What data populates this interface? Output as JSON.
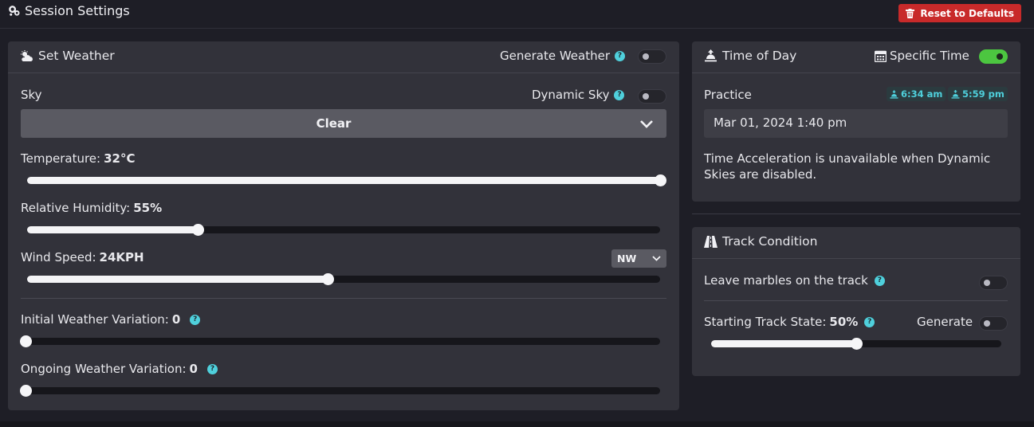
{
  "header": {
    "title": "Session Settings",
    "reset_label": "Reset to Defaults"
  },
  "weather": {
    "title": "Set Weather",
    "generate_label": "Generate Weather",
    "generate_on": false,
    "sky": {
      "label": "Sky",
      "dynamic_label": "Dynamic Sky",
      "dynamic_on": false,
      "selected": "Clear"
    },
    "temperature": {
      "label": "Temperature:",
      "value": "32°C",
      "fraction": 1.0
    },
    "humidity": {
      "label": "Relative Humidity:",
      "value": "55%",
      "fraction": 0.27
    },
    "wind": {
      "label": "Wind Speed:",
      "value": "24KPH",
      "direction": "NW",
      "fraction": 0.475
    },
    "initial_variation": {
      "label": "Initial Weather Variation:",
      "value": "0",
      "fraction": 0
    },
    "ongoing_variation": {
      "label": "Ongoing Weather Variation:",
      "value": "0",
      "fraction": 0
    }
  },
  "time": {
    "title": "Time of Day",
    "specific_label": "Specific Time",
    "specific_on": true,
    "session": "Practice",
    "sunrise": "6:34 am",
    "sunset": "5:59 pm",
    "datetime": "Mar 01, 2024 1:40 pm",
    "note": "Time Acceleration is unavailable when Dynamic Skies are disabled."
  },
  "track": {
    "title": "Track Condition",
    "marbles_label": "Leave marbles on the track",
    "marbles_on": false,
    "state_label": "Starting Track State:",
    "state_value": "50%",
    "state_fraction": 0.5,
    "generate_label": "Generate",
    "generate_on": false
  },
  "colors": {
    "accent": "#4fd0dc",
    "toggle_on": "#4cc640",
    "danger": "#c82a2a",
    "panel": "#32323a",
    "background": "#1e1e26"
  }
}
